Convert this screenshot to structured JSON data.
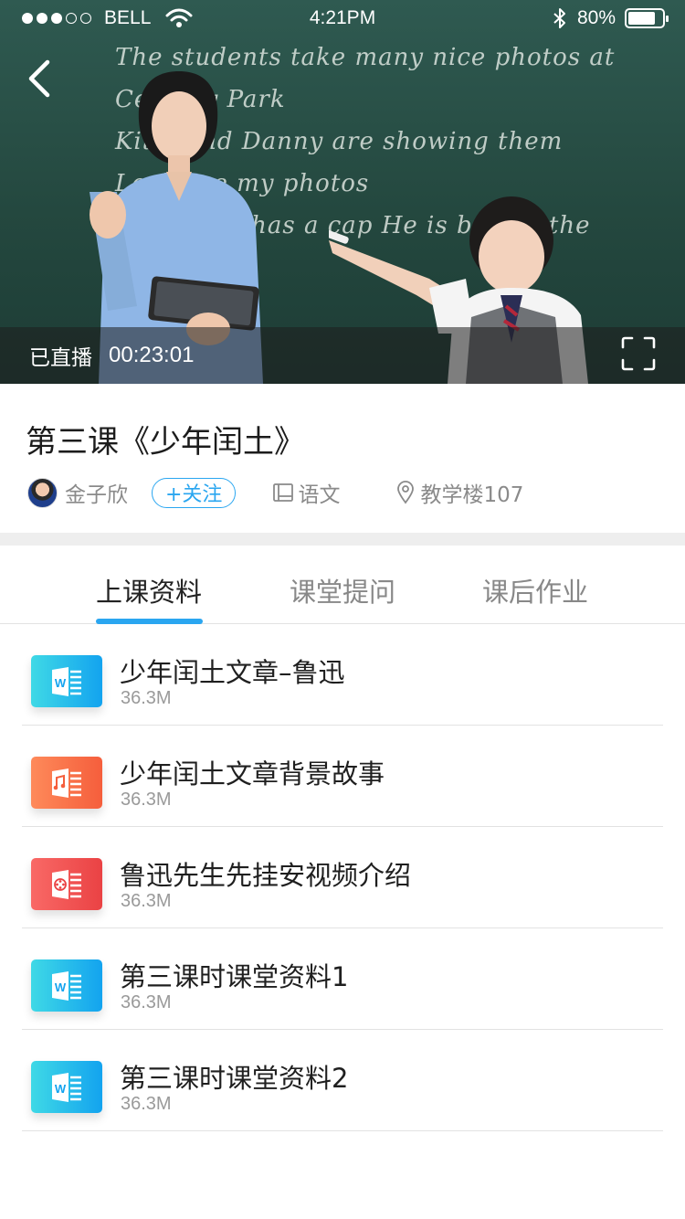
{
  "status_bar": {
    "carrier": "BELL",
    "time": "4:21PM",
    "battery": "80%",
    "battery_level": 0.8,
    "signal_bars_filled": 3,
    "signal_bars_total": 5
  },
  "video": {
    "board_lines": [
      "The students take many nice photos at Century Park",
      "Kitty        and Danny are showing them",
      "Look        are my photos",
      "This          y. He has a cap He is beside the"
    ],
    "live_status": "已直播",
    "elapsed": "00:23:01"
  },
  "course": {
    "title": "第三课《少年闰土》",
    "teacher": "金子欣",
    "follow_label": "+关注",
    "subject": "语文",
    "location": "教学楼107"
  },
  "tabs": [
    {
      "label": "上课资料",
      "active": true
    },
    {
      "label": "课堂提问",
      "active": false
    },
    {
      "label": "课后作业",
      "active": false
    }
  ],
  "files": [
    {
      "name": "少年闰土文章–鲁迅",
      "size": "36.3M",
      "icon": "word-doc-icon"
    },
    {
      "name": "少年闰土文章背景故事",
      "size": "36.3M",
      "icon": "audio-file-icon"
    },
    {
      "name": "鲁迅先生先挂安视频介绍",
      "size": "36.3M",
      "icon": "video-file-icon"
    },
    {
      "name": "第三课时课堂资料1",
      "size": "36.3M",
      "icon": "word-doc-icon"
    },
    {
      "name": "第三课时课堂资料2",
      "size": "36.3M",
      "icon": "word-doc-icon"
    }
  ],
  "colors": {
    "accent": "#2aa6f0",
    "word_icon": "#13a3ef",
    "audio_icon": "#f55e3c",
    "video_icon": "#ea4244"
  }
}
